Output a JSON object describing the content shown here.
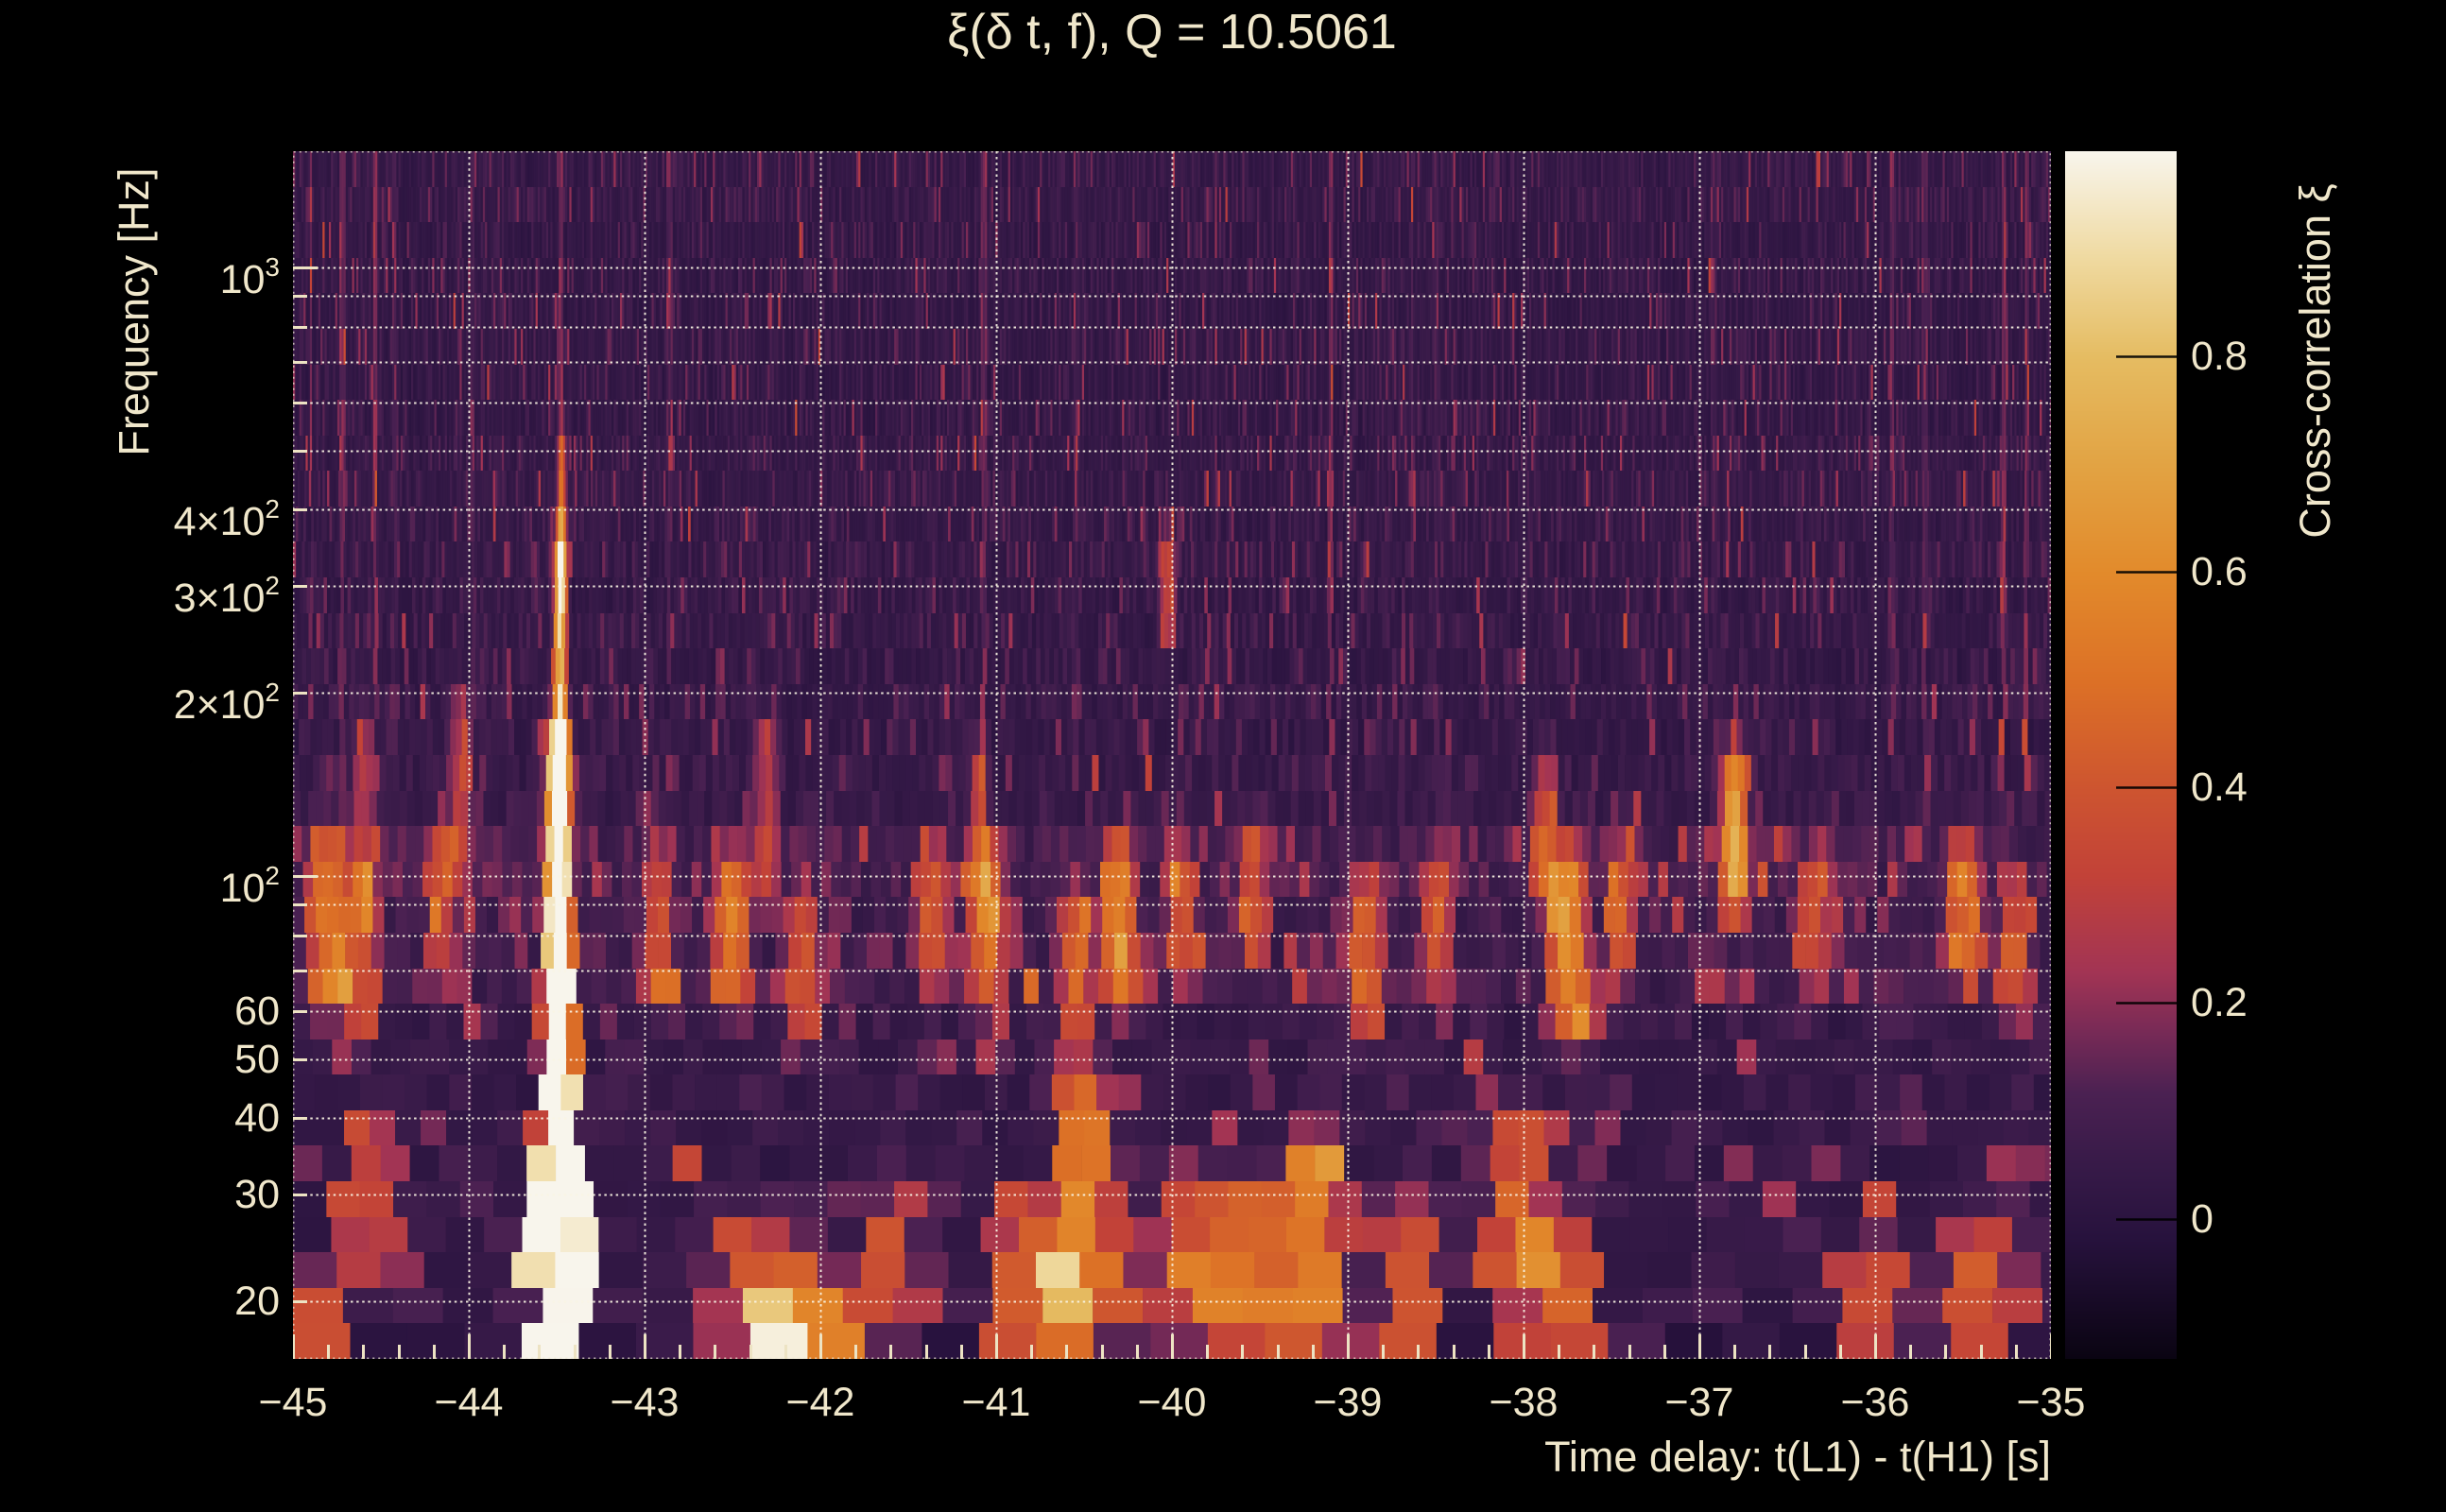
{
  "page": {
    "background": "#000000",
    "text_color": "#f0e7cb"
  },
  "chart_data": {
    "type": "heatmap",
    "title": "ξ(δ t, f), Q = 10.5061",
    "xlabel": "Time delay: t(L1) - t(H1) [s]",
    "ylabel": "Frequency [Hz]",
    "colorbar_label": "Cross-correlation ξ",
    "x_range": [
      -45,
      -35
    ],
    "y_range_hz": [
      16.1,
      1553
    ],
    "y_scale": "log",
    "value_range": [
      -0.13,
      0.99
    ],
    "x_ticks": [
      {
        "v": -45,
        "label": "−45"
      },
      {
        "v": -44,
        "label": "−44"
      },
      {
        "v": -43,
        "label": "−43"
      },
      {
        "v": -42,
        "label": "−42"
      },
      {
        "v": -41,
        "label": "−41"
      },
      {
        "v": -40,
        "label": "−40"
      },
      {
        "v": -39,
        "label": "−39"
      },
      {
        "v": -38,
        "label": "−38"
      },
      {
        "v": -37,
        "label": "−37"
      },
      {
        "v": -36,
        "label": "−36"
      },
      {
        "v": -35,
        "label": "−35"
      }
    ],
    "x_minor_step": 0.2,
    "y_ticks": [
      {
        "f": 1000,
        "m": "10",
        "e": "3"
      },
      {
        "f": 400,
        "m": "4×10",
        "e": "2"
      },
      {
        "f": 300,
        "m": "3×10",
        "e": "2"
      },
      {
        "f": 200,
        "m": "2×10",
        "e": "2"
      },
      {
        "f": 100,
        "m": "10",
        "e": "2"
      },
      {
        "f": 60,
        "m": "60"
      },
      {
        "f": 50,
        "m": "50"
      },
      {
        "f": 40,
        "m": "40"
      },
      {
        "f": 30,
        "m": "30"
      },
      {
        "f": 20,
        "m": "20"
      }
    ],
    "x_gridlines": [
      -44,
      -43,
      -42,
      -41,
      -40,
      -39,
      -38,
      -37,
      -36
    ],
    "y_gridlines": [
      20,
      30,
      40,
      50,
      60,
      70,
      80,
      90,
      100,
      200,
      300,
      400,
      500,
      600,
      700,
      800,
      900,
      1000
    ],
    "colorbar_ticks": [
      {
        "v": 0.8,
        "label": "0.8"
      },
      {
        "v": 0.6,
        "label": "0.6"
      },
      {
        "v": 0.4,
        "label": "0.4"
      },
      {
        "v": 0.2,
        "label": "0.2"
      },
      {
        "v": 0,
        "label": "0"
      }
    ],
    "grid": {
      "color": "rgba(250,244,228,0.92)",
      "dash": [
        2.5,
        3.6
      ],
      "width": 2
    },
    "tick_style": {
      "color": "#ede3c3",
      "width": 3,
      "major_len": 26,
      "minor_len": 15
    },
    "colormap": [
      [
        0.0,
        "#0a0412"
      ],
      [
        0.1,
        "#27123d"
      ],
      [
        0.16,
        "#371a48"
      ],
      [
        0.22,
        "#4b2152"
      ],
      [
        0.27,
        "#772a56"
      ],
      [
        0.32,
        "#a23454"
      ],
      [
        0.4,
        "#c24238"
      ],
      [
        0.47,
        "#cd5430"
      ],
      [
        0.56,
        "#dc7026"
      ],
      [
        0.65,
        "#e28a2b"
      ],
      [
        0.74,
        "#e2a343"
      ],
      [
        0.83,
        "#e5bc62"
      ],
      [
        0.91,
        "#efd99f"
      ],
      [
        1.0,
        "#f8f5ec"
      ]
    ],
    "noise": {
      "seed": 20,
      "rows": 34,
      "tile_time_factor": 5.6,
      "min_tile_dt": 0.012,
      "base": 0.012,
      "exp_scale": 0.045,
      "jitter": 0.02,
      "row_jitter": 0.016,
      "band_boost": {
        "f_lo": 58,
        "f_hi": 118,
        "add": 0.018,
        "exp_scale": 0.038
      },
      "bottom_band": {
        "f_hi": 19.5,
        "base": -0.03,
        "exp_scale": 0.05
      },
      "col_streak_prob": 0.018,
      "col_streak_amp": [
        0.05,
        0.21
      ],
      "col_smooth_amp": 0.01
    },
    "features_format": [
      "t_center_s",
      "sigma_s",
      "f_lo_hz",
      "f_hi_hz",
      "peak_xi"
    ],
    "features": [
      [
        -43.49,
        0.035,
        16.5,
        155,
        0.97
      ],
      [
        -43.48,
        0.02,
        150,
        330,
        0.6
      ],
      [
        -43.47,
        0.015,
        300,
        470,
        0.33
      ],
      [
        -44.8,
        0.05,
        68,
        102,
        0.42
      ],
      [
        -44.62,
        0.04,
        62,
        86,
        0.3
      ],
      [
        -44.15,
        0.04,
        80,
        105,
        0.25
      ],
      [
        -42.92,
        0.04,
        70,
        95,
        0.28
      ],
      [
        -42.5,
        0.05,
        68,
        96,
        0.4
      ],
      [
        -42.1,
        0.04,
        60,
        80,
        0.3
      ],
      [
        -41.35,
        0.04,
        75,
        100,
        0.3
      ],
      [
        -41.05,
        0.05,
        70,
        100,
        0.38
      ],
      [
        -40.55,
        0.04,
        60,
        85,
        0.33
      ],
      [
        -40.3,
        0.05,
        70,
        100,
        0.45
      ],
      [
        -39.95,
        0.04,
        78,
        98,
        0.3
      ],
      [
        -39.55,
        0.04,
        85,
        105,
        0.28
      ],
      [
        -38.9,
        0.05,
        62,
        88,
        0.35
      ],
      [
        -38.5,
        0.04,
        75,
        95,
        0.28
      ],
      [
        -37.75,
        0.05,
        62,
        98,
        0.52
      ],
      [
        -37.45,
        0.04,
        80,
        100,
        0.3
      ],
      [
        -36.8,
        0.04,
        95,
        140,
        0.32
      ],
      [
        -36.35,
        0.04,
        75,
        95,
        0.3
      ],
      [
        -35.5,
        0.05,
        78,
        100,
        0.4
      ],
      [
        -35.2,
        0.04,
        65,
        85,
        0.28
      ],
      [
        -44.55,
        0.06,
        24,
        36,
        0.25
      ],
      [
        -42.35,
        0.08,
        18,
        24,
        0.3
      ],
      [
        -41.6,
        0.06,
        19,
        26,
        0.25
      ],
      [
        -40.8,
        0.07,
        18,
        26,
        0.4
      ],
      [
        -40.5,
        0.06,
        20,
        42,
        0.48
      ],
      [
        -39.95,
        0.06,
        20,
        30,
        0.28
      ],
      [
        -39.6,
        0.07,
        18,
        28,
        0.38
      ],
      [
        -39.2,
        0.06,
        19,
        33,
        0.5
      ],
      [
        -38.65,
        0.06,
        17,
        26,
        0.35
      ],
      [
        -38.05,
        0.07,
        24,
        36,
        0.3
      ],
      [
        -37.8,
        0.06,
        17,
        24,
        0.35
      ],
      [
        -36.0,
        0.06,
        16,
        22,
        0.33
      ],
      [
        -35.4,
        0.07,
        16,
        24,
        0.35
      ],
      [
        -42.1,
        0.1,
        16,
        19.5,
        0.55
      ],
      [
        -44.9,
        0.08,
        16,
        19,
        0.3
      ],
      [
        -44.6,
        0.03,
        100,
        160,
        0.22
      ],
      [
        -44.05,
        0.03,
        110,
        180,
        0.2
      ],
      [
        -42.3,
        0.03,
        100,
        160,
        0.22
      ],
      [
        -41.1,
        0.03,
        100,
        150,
        0.2
      ],
      [
        -40.03,
        0.025,
        270,
        330,
        0.28
      ],
      [
        -37.88,
        0.035,
        100,
        135,
        0.3
      ],
      [
        -36.8,
        0.03,
        100,
        140,
        0.28
      ]
    ]
  }
}
